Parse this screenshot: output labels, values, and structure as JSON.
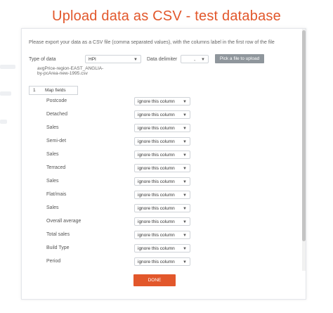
{
  "title": "Upload data as CSV - test database",
  "intro": "Please export your data as a CSV file (comma separated values), with the columns label in the first row of the file",
  "type_of_data": {
    "label": "Type of data",
    "value": "HPI"
  },
  "delimiter": {
    "label": "Data delimiter",
    "value": ","
  },
  "pick_file_button": "Pick a file to upload",
  "filename": "avgPrice-region-EAST_ANGLIA-by-pcArea-new-1995.csv",
  "map_fields": {
    "number": "1",
    "label": "Map fields"
  },
  "fields": [
    {
      "name": "Postcode",
      "mapping": "ignore this column"
    },
    {
      "name": "Detached",
      "mapping": "ignore this column"
    },
    {
      "name": "Sales",
      "mapping": "ignore this column"
    },
    {
      "name": "Semi-det",
      "mapping": "ignore this column"
    },
    {
      "name": "Sales",
      "mapping": "ignore this column"
    },
    {
      "name": "Terraced",
      "mapping": "ignore this column"
    },
    {
      "name": "Sales",
      "mapping": "ignore this column"
    },
    {
      "name": "Flat/mais",
      "mapping": "ignore this column"
    },
    {
      "name": "Sales",
      "mapping": "ignore this column"
    },
    {
      "name": "Overall average",
      "mapping": "ignore this column"
    },
    {
      "name": "Total sales",
      "mapping": "ignore this column"
    },
    {
      "name": "Build Type",
      "mapping": "ignore this column"
    },
    {
      "name": "Period",
      "mapping": "ignore this column"
    }
  ],
  "done_button": "DONE",
  "colors": {
    "accent": "#e2572b",
    "pick_button": "#8f969c"
  }
}
